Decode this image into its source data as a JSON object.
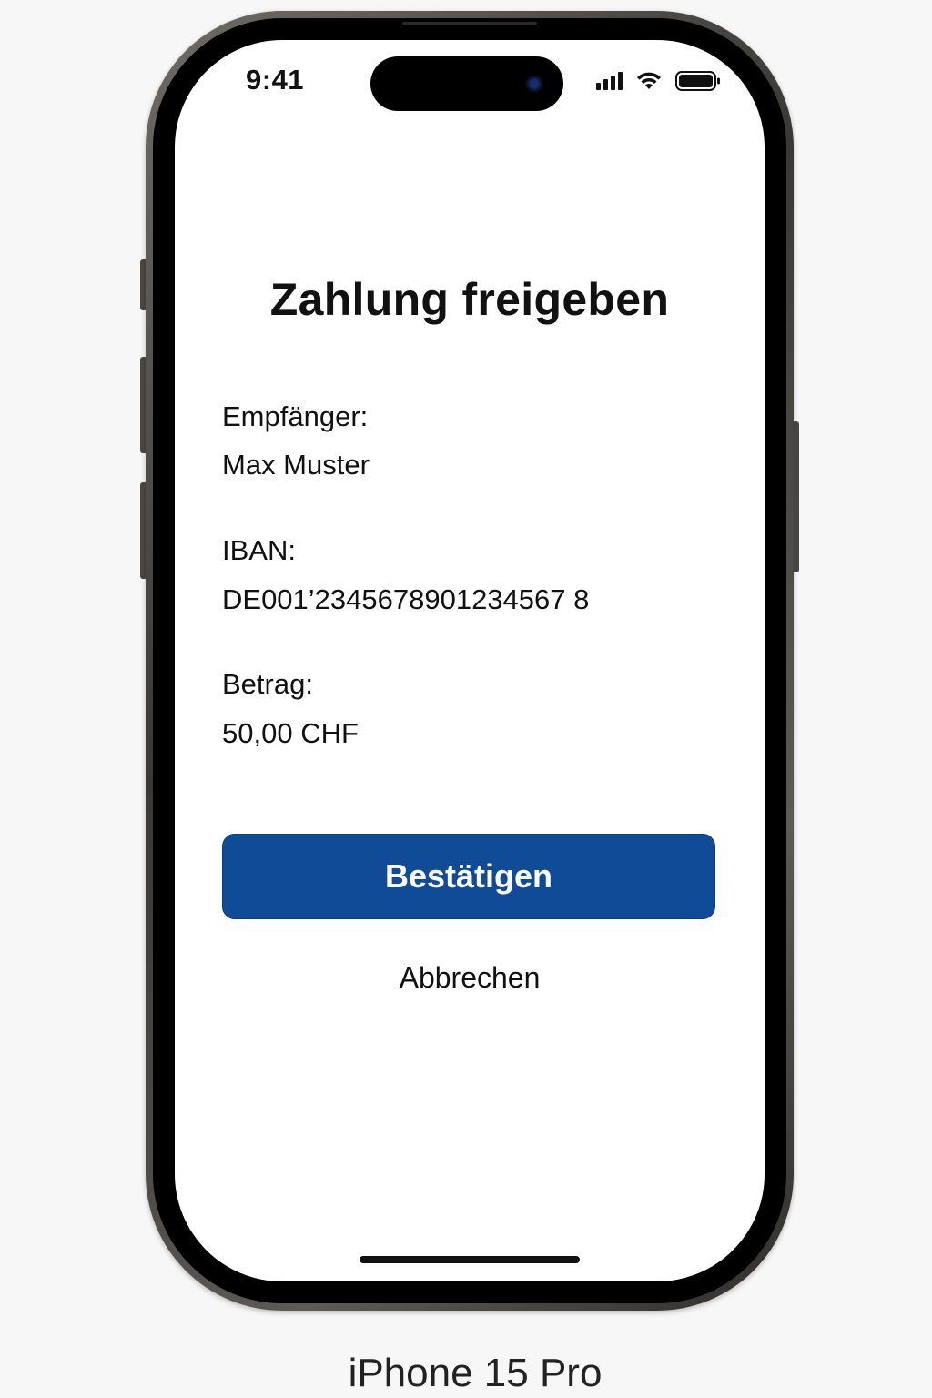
{
  "status_bar": {
    "time": "9:41",
    "icons": [
      "signal-icon",
      "wifi-icon",
      "battery-icon"
    ]
  },
  "screen": {
    "title": "Zahlung freigeben",
    "fields": [
      {
        "label": "Empfänger:",
        "value": "Max Muster"
      },
      {
        "label": "IBAN:",
        "value": "DE001’2345678901234567 8"
      },
      {
        "label": "Betrag:",
        "value": "50,00 CHF"
      }
    ],
    "confirm_label": "Bestätigen",
    "cancel_label": "Abbrechen"
  },
  "device_caption": "iPhone 15 Pro",
  "colors": {
    "accent": "#0f4b96",
    "text": "#111111",
    "screen_bg": "#ffffff",
    "page_bg": "#f7f7f7"
  }
}
